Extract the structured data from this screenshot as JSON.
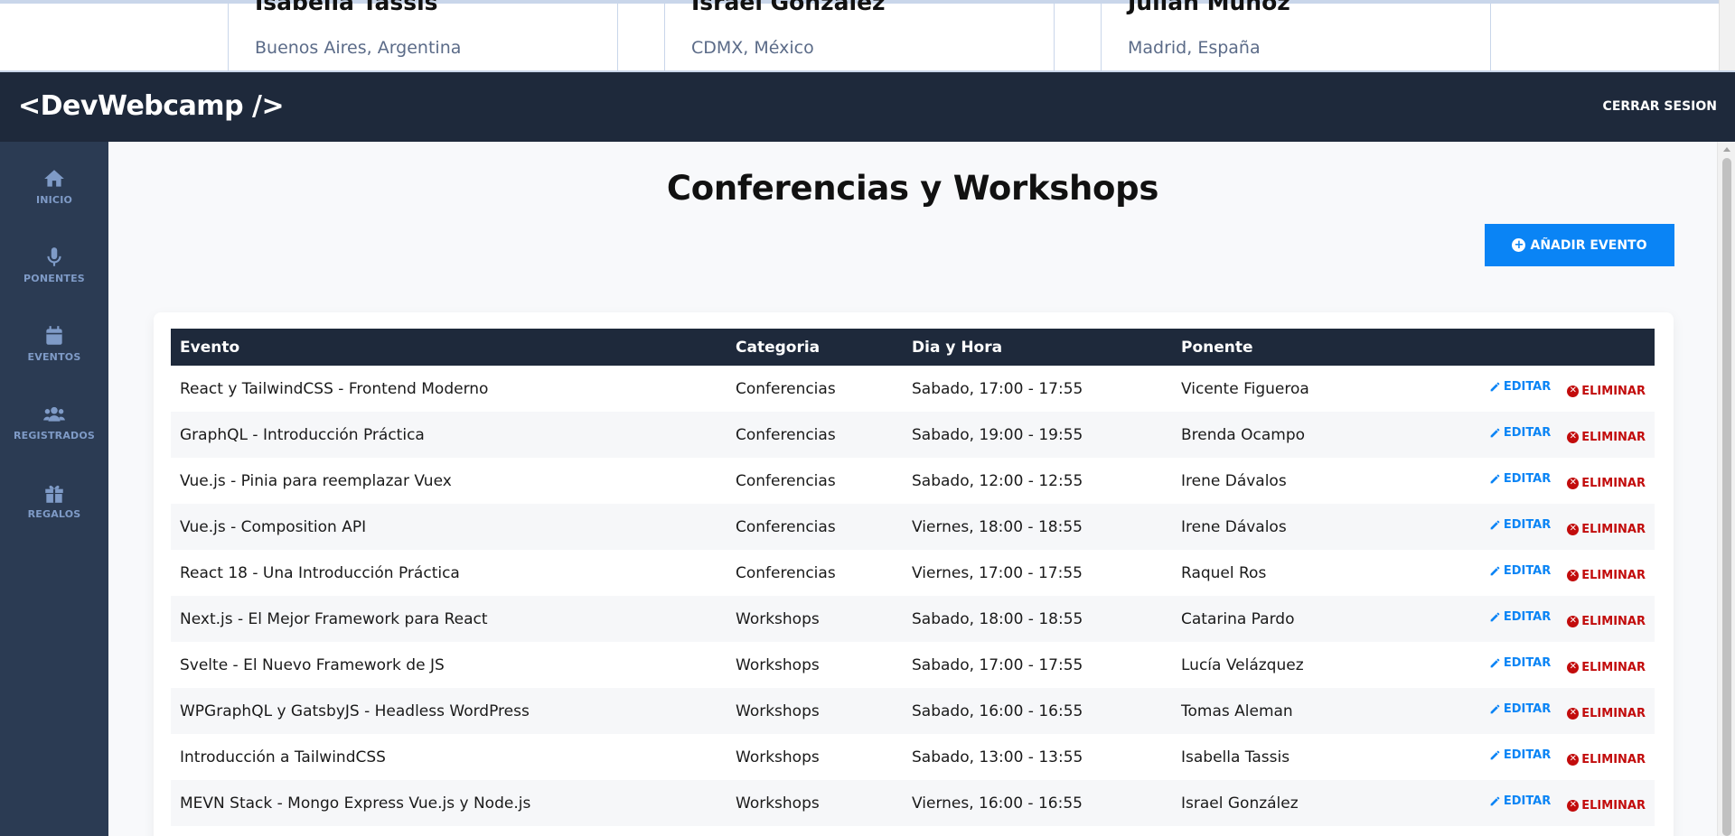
{
  "background_page": {
    "speakers": [
      {
        "name": "Isabella Tassis",
        "location": "Buenos Aires, Argentina"
      },
      {
        "name": "Israel González",
        "location": "CDMX, México"
      },
      {
        "name": "Julián Muñoz",
        "location": "Madrid, España"
      }
    ]
  },
  "header": {
    "logo": "<DevWebcamp />",
    "logout": "CERRAR SESION"
  },
  "sidebar": {
    "items": [
      {
        "label": "INICIO",
        "icon": "home-icon"
      },
      {
        "label": "PONENTES",
        "icon": "microphone-icon"
      },
      {
        "label": "EVENTOS",
        "icon": "calendar-icon"
      },
      {
        "label": "REGISTRADOS",
        "icon": "users-icon"
      },
      {
        "label": "REGALOS",
        "icon": "gift-icon"
      }
    ]
  },
  "main": {
    "title": "Conferencias y Workshops",
    "add_button": "AÑADIR EVENTO",
    "add_icon": "+"
  },
  "table": {
    "headers": [
      "Evento",
      "Categoria",
      "Dia y Hora",
      "Ponente"
    ],
    "edit_label": "EDITAR",
    "delete_label": "ELIMINAR",
    "rows": [
      {
        "evento": "React y TailwindCSS - Frontend Moderno",
        "categoria": "Conferencias",
        "dia_hora": "Sabado, 17:00 - 17:55",
        "ponente": "Vicente Figueroa"
      },
      {
        "evento": "GraphQL - Introducción Práctica",
        "categoria": "Conferencias",
        "dia_hora": "Sabado, 19:00 - 19:55",
        "ponente": "Brenda Ocampo"
      },
      {
        "evento": "Vue.js - Pinia para reemplazar Vuex",
        "categoria": "Conferencias",
        "dia_hora": "Sabado, 12:00 - 12:55",
        "ponente": "Irene Dávalos"
      },
      {
        "evento": "Vue.js - Composition API",
        "categoria": "Conferencias",
        "dia_hora": "Viernes, 18:00 - 18:55",
        "ponente": "Irene Dávalos"
      },
      {
        "evento": "React 18 - Una Introducción Práctica",
        "categoria": "Conferencias",
        "dia_hora": "Viernes, 17:00 - 17:55",
        "ponente": "Raquel Ros"
      },
      {
        "evento": "Next.js - El Mejor Framework para React",
        "categoria": "Workshops",
        "dia_hora": "Sabado, 18:00 - 18:55",
        "ponente": "Catarina Pardo"
      },
      {
        "evento": "Svelte - El Nuevo Framework de JS",
        "categoria": "Workshops",
        "dia_hora": "Sabado, 17:00 - 17:55",
        "ponente": "Lucía Velázquez"
      },
      {
        "evento": "WPGraphQL y GatsbyJS - Headless WordPress",
        "categoria": "Workshops",
        "dia_hora": "Sabado, 16:00 - 16:55",
        "ponente": "Tomas Aleman"
      },
      {
        "evento": "Introducción a TailwindCSS",
        "categoria": "Workshops",
        "dia_hora": "Sabado, 13:00 - 13:55",
        "ponente": "Isabella Tassis"
      },
      {
        "evento": "MEVN Stack - Mongo Express Vue.js y Node.js",
        "categoria": "Workshops",
        "dia_hora": "Viernes, 16:00 - 16:55",
        "ponente": "Israel González"
      }
    ]
  },
  "colors": {
    "header_bg": "#1e293b",
    "sidebar_bg": "#2b3b53",
    "sidebar_text": "#7f9bc7",
    "accent_blue": "#0a84f5",
    "danger_red": "#c20c0c",
    "page_bg": "#f8f9fb"
  }
}
